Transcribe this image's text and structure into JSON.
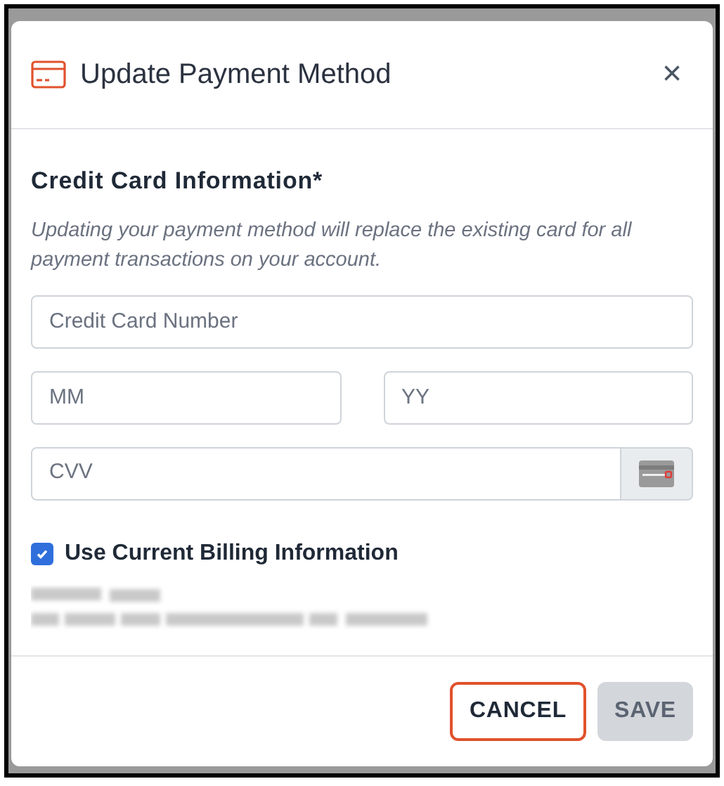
{
  "dialog": {
    "title": "Update Payment Method",
    "close": "×"
  },
  "section": {
    "heading": "Credit Card Information*",
    "description": "Updating your payment method will replace the existing card for all payment transactions on your account."
  },
  "fields": [
    {
      "placeholder": "Credit Card Number",
      "kind": "full"
    },
    {
      "placeholder": "MM",
      "kind": "half"
    },
    {
      "placeholder": "YY",
      "kind": "half"
    },
    {
      "placeholder": "CVV",
      "kind": "addon"
    }
  ],
  "billing": {
    "label": "Use Current Billing Information",
    "checked": true
  },
  "buttons": [
    {
      "label": "CANCEL",
      "kind": "outline",
      "disabled": false
    },
    {
      "label": "SAVE",
      "kind": "primary",
      "disabled": true
    }
  ]
}
